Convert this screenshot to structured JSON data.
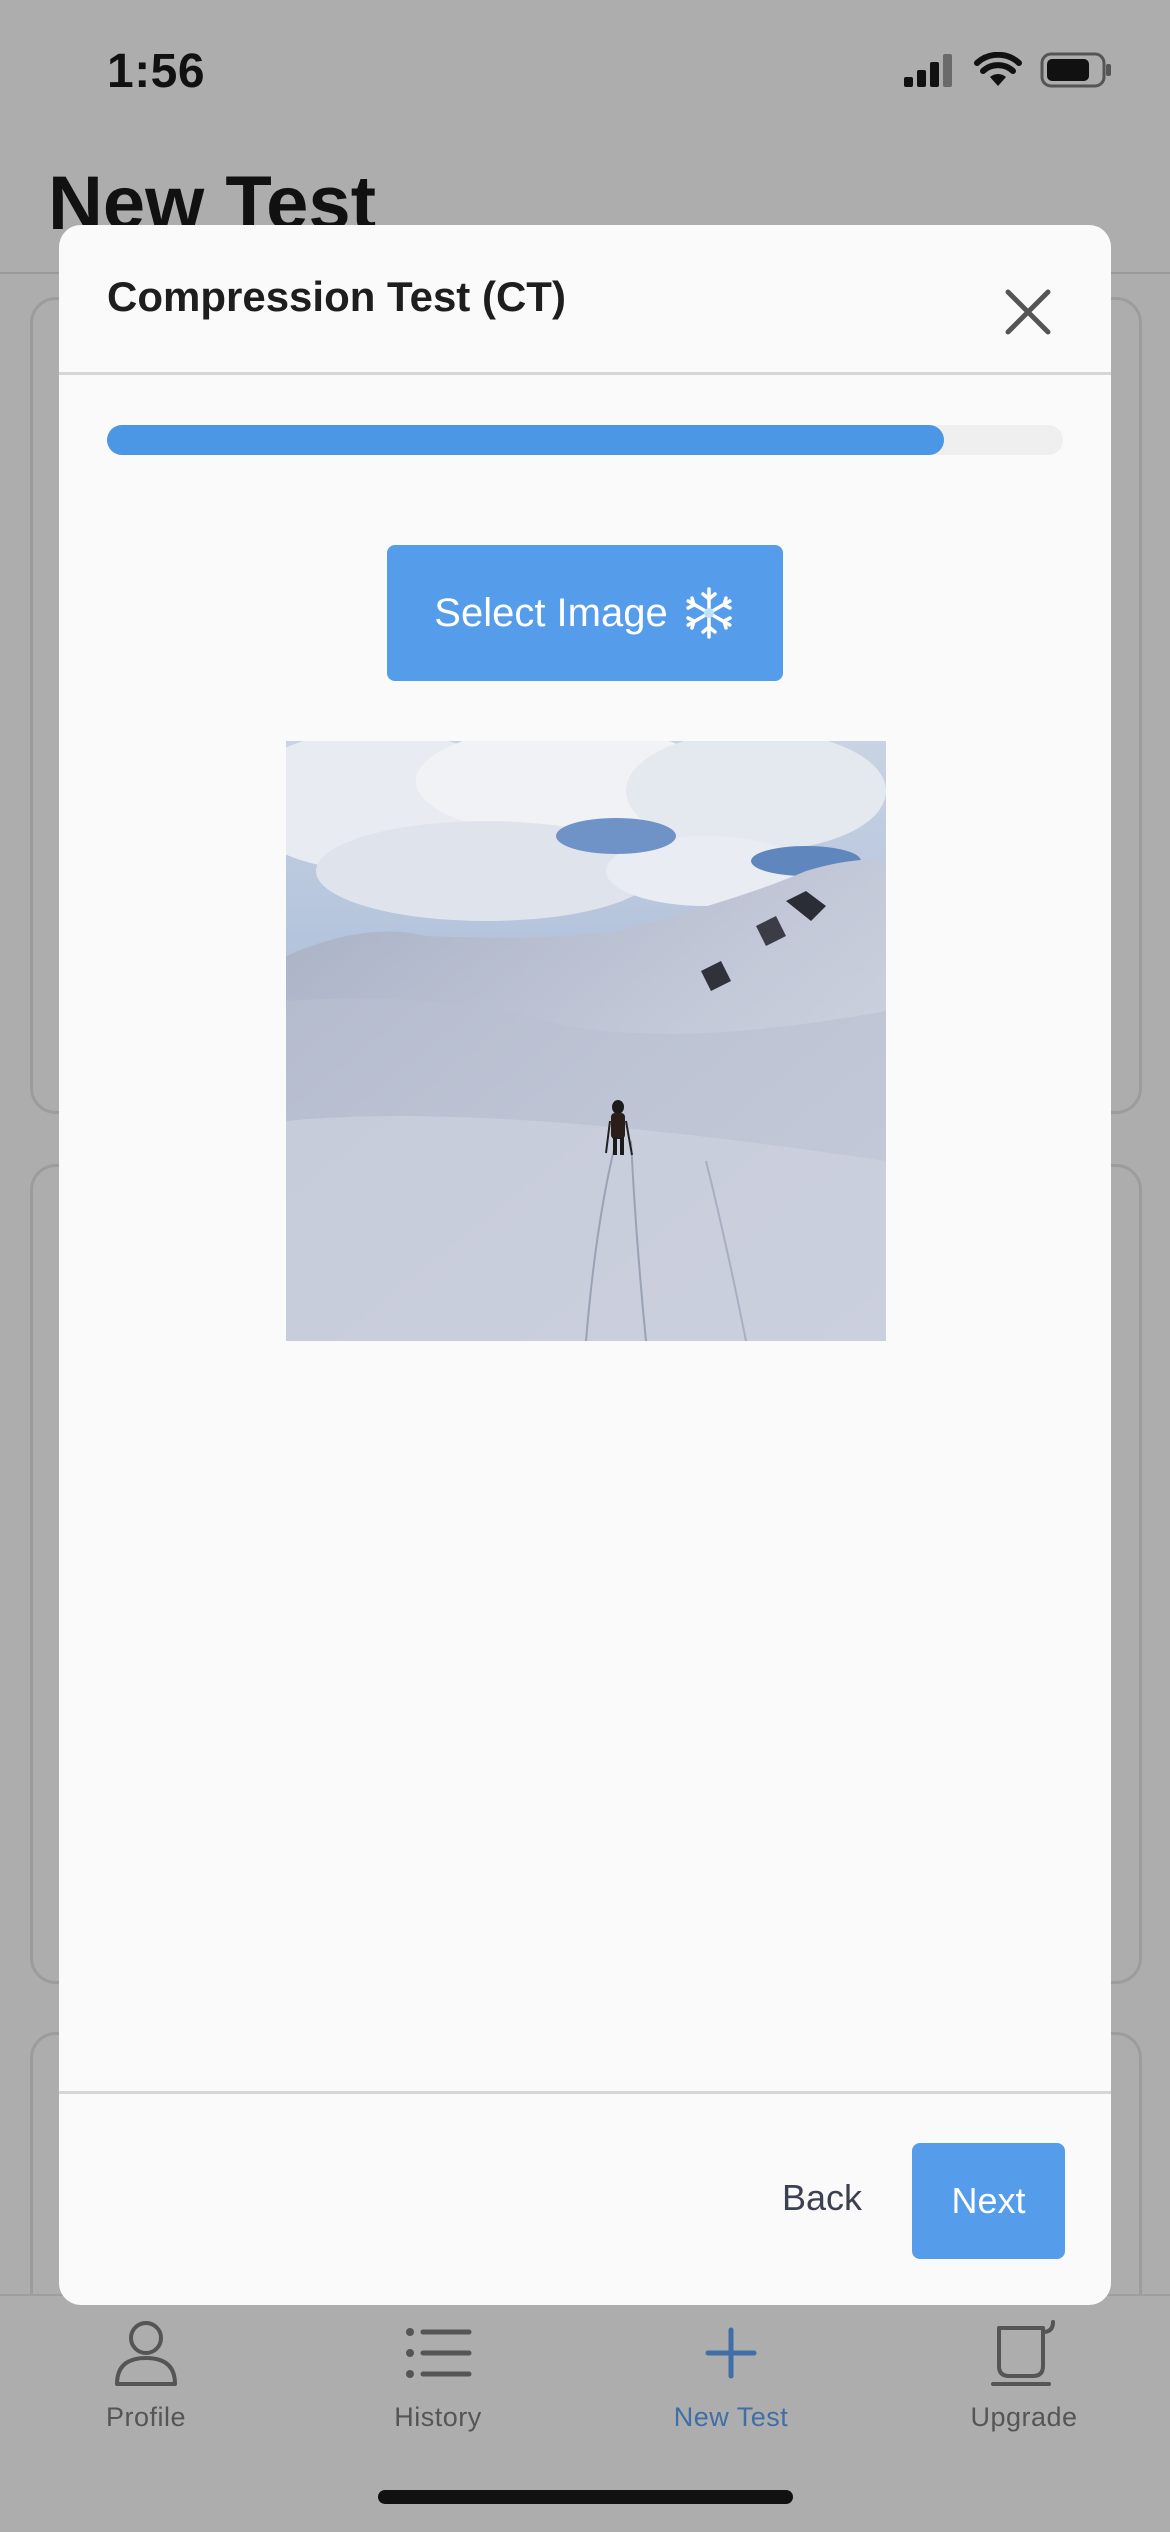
{
  "status_bar": {
    "time": "1:56",
    "icons": [
      "signal-icon",
      "wifi-icon",
      "battery-icon"
    ]
  },
  "background": {
    "title": "New Test"
  },
  "modal": {
    "title": "Compression Test (CT)",
    "close_icon": "close-icon",
    "progress": 0.875,
    "progress_color": "#4c96e6",
    "select_image_label": "Select Image",
    "select_image_emoji": "❄️",
    "back_label": "Back",
    "next_label": "Next",
    "accent_color": "#559ceb"
  },
  "tabbar": {
    "tabs": [
      {
        "label": "Profile",
        "icon": "person-icon",
        "active": false
      },
      {
        "label": "History",
        "icon": "list-icon",
        "active": false
      },
      {
        "label": "New Test",
        "icon": "plus-icon",
        "active": true
      },
      {
        "label": "Upgrade",
        "icon": "coffee-cup-icon",
        "active": false
      }
    ],
    "active_color": "#3f6fa6"
  }
}
